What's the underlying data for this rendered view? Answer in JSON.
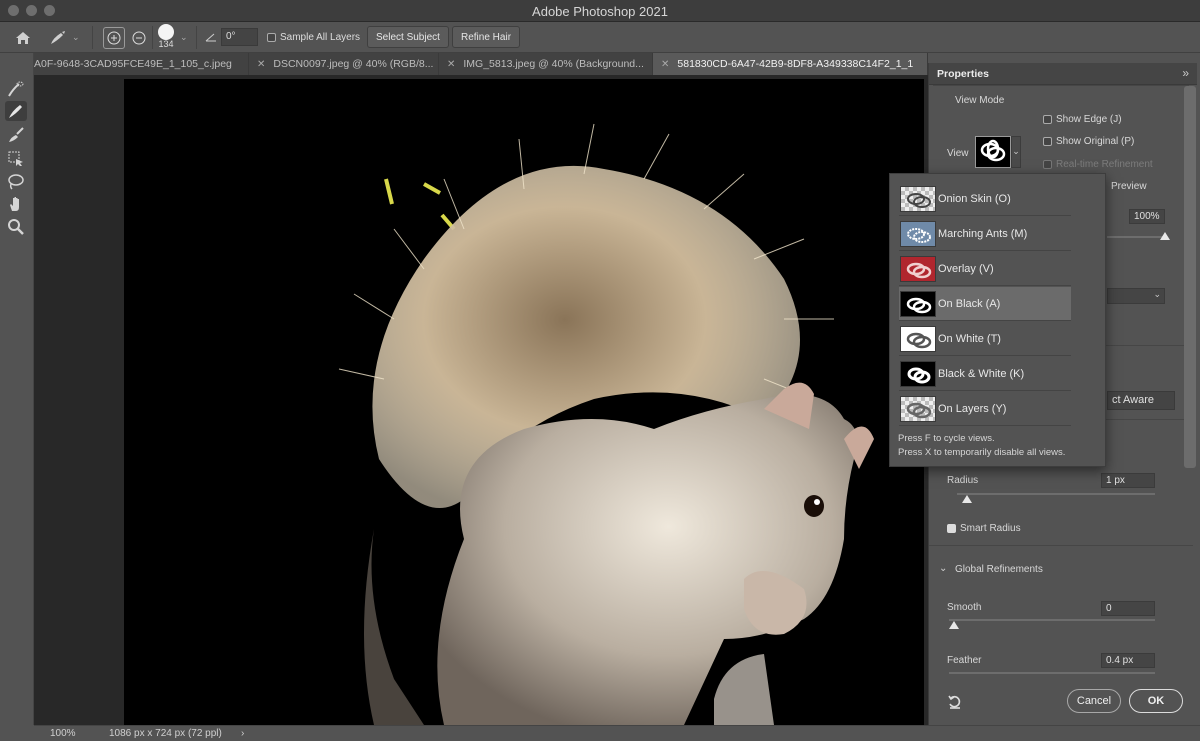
{
  "window": {
    "title": "Adobe Photoshop 2021"
  },
  "options_bar": {
    "brush_size": "134",
    "angle": "0°",
    "sample_all_layers": "Sample All Layers",
    "select_subject": "Select Subject",
    "refine_hair": "Refine Hair"
  },
  "tabs": [
    {
      "label": "A0F-9648-3CAD95FCE49E_1_105_c.jpeg"
    },
    {
      "label": "DSCN0097.jpeg @ 40% (RGB/8..."
    },
    {
      "label": "IMG_5813.jpeg @ 40% (Background..."
    },
    {
      "label": "581830CD-6A47-42B9-8DF8-A349338C14F2_1_1"
    }
  ],
  "status_bar": {
    "zoom": "100%",
    "doc_size": "1086 px x 724 px (72 ppl)"
  },
  "properties": {
    "title": "Properties",
    "view_mode_label": "View Mode",
    "view_label": "View",
    "show_edge": "Show Edge (J)",
    "show_original": "Show Original (P)",
    "realtime_refinement": "Real-time Refinement",
    "preview": "Preview",
    "opacity": "100%",
    "object_aware": "ct Aware",
    "radius_label": "Radius",
    "radius_value": "1 px",
    "smart_radius": "Smart Radius",
    "global_refinements": "Global Refinements",
    "smooth_label": "Smooth",
    "smooth_value": "0",
    "feather_label": "Feather",
    "feather_value": "0.4 px",
    "cancel": "Cancel",
    "ok": "OK"
  },
  "view_menu": {
    "items": [
      {
        "label": "Onion Skin (O)"
      },
      {
        "label": "Marching Ants (M)"
      },
      {
        "label": "Overlay (V)"
      },
      {
        "label": "On Black (A)"
      },
      {
        "label": "On White (T)"
      },
      {
        "label": "Black & White (K)"
      },
      {
        "label": "On Layers (Y)"
      }
    ],
    "selected": "On Black (A)",
    "hint1": "Press F to cycle views.",
    "hint2": "Press X to temporarily disable all views."
  },
  "colors": {
    "overlay_red": "#b0262e",
    "selected_row": "#6b6b6b"
  }
}
